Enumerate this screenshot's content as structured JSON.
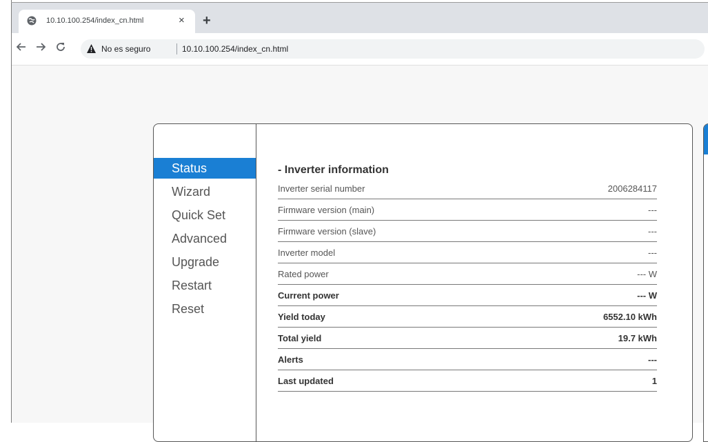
{
  "browser": {
    "tab_title": "10.10.100.254/index_cn.html",
    "tab_close": "×",
    "new_tab": "+",
    "security_label": "No es seguro",
    "url": "10.10.100.254/index_cn.html",
    "icons": {
      "back": "back-arrow-icon",
      "forward": "forward-arrow-icon",
      "reload": "reload-icon",
      "warning": "warning-triangle-icon",
      "globe": "globe-icon"
    }
  },
  "menu": {
    "items": [
      {
        "label": "Status"
      },
      {
        "label": "Wizard"
      },
      {
        "label": "Quick Set"
      },
      {
        "label": "Advanced"
      },
      {
        "label": "Upgrade"
      },
      {
        "label": "Restart"
      },
      {
        "label": "Reset"
      }
    ],
    "active_label": "Status"
  },
  "inverter": {
    "title": "- Inverter information",
    "rows": [
      {
        "label": "Inverter serial number",
        "value": "2006284117"
      },
      {
        "label": "Firmware version (main)",
        "value": "---"
      },
      {
        "label": "Firmware version (slave)",
        "value": "---"
      },
      {
        "label": "Inverter model",
        "value": "---"
      },
      {
        "label": "Rated power",
        "value": "--- W"
      },
      {
        "label": "Current power",
        "value": "--- W"
      },
      {
        "label": "Yield today",
        "value": "6552.10 kWh"
      },
      {
        "label": "Total yield",
        "value": "19.7 kWh"
      },
      {
        "label": "Alerts",
        "value": "---"
      },
      {
        "label": "Last updated",
        "value": "1"
      }
    ]
  },
  "colors": {
    "accent": "#1a7fd4",
    "tabstrip": "#dee1e6",
    "omnibox": "#f1f3f4"
  }
}
